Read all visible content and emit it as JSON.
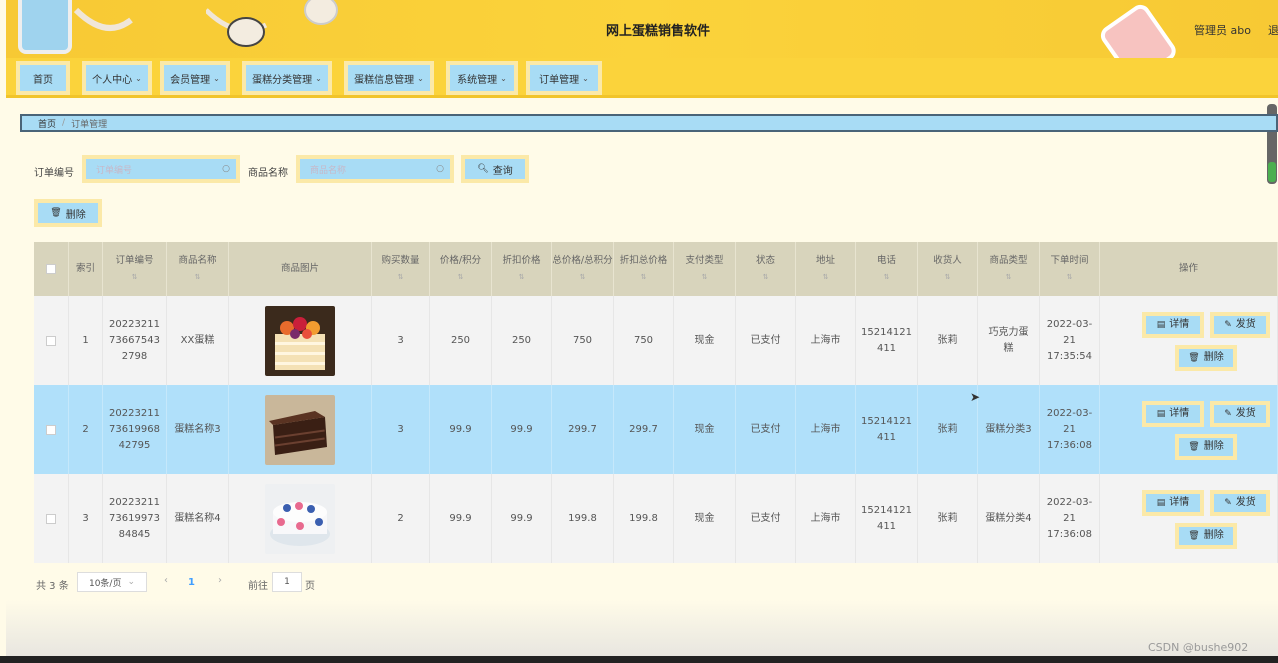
{
  "header": {
    "title": "网上蛋糕销售软件",
    "user": "管理员 abo",
    "logout": "退出"
  },
  "nav": [
    {
      "label": "首页",
      "has_menu": false
    },
    {
      "label": "个人中心",
      "has_menu": true
    },
    {
      "label": "会员管理",
      "has_menu": true
    },
    {
      "label": "蛋糕分类管理",
      "has_menu": true
    },
    {
      "label": "蛋糕信息管理",
      "has_menu": true
    },
    {
      "label": "系统管理",
      "has_menu": true
    },
    {
      "label": "订单管理",
      "has_menu": true
    }
  ],
  "breadcrumb": {
    "home": "首页",
    "separator": "/",
    "current": "订单管理"
  },
  "search": {
    "order_label": "订单编号",
    "order_placeholder": "订单编号",
    "product_label": "商品名称",
    "product_placeholder": "商品名称",
    "query_button": "查询"
  },
  "toolbar": {
    "delete_button": "删除"
  },
  "table": {
    "headers": [
      "索引",
      "订单编号",
      "商品名称",
      "商品图片",
      "购买数量",
      "价格/积分",
      "折扣价格",
      "总价格/总积分",
      "折扣总价格",
      "支付类型",
      "状态",
      "地址",
      "电话",
      "收货人",
      "商品类型",
      "下单时间",
      "操作"
    ],
    "rows": [
      {
        "index": "1",
        "order_no": "20223211 73667543 2798",
        "product": "XX蛋糕",
        "qty": "3",
        "price": "250",
        "discount": "250",
        "total": "750",
        "discount_total": "750",
        "pay": "现金",
        "status": "已支付",
        "address": "上海市",
        "phone": "15214121 411",
        "receiver": "张莉",
        "type": "巧克力蛋糕",
        "time": "2022-03-21 17:35:54",
        "image": "fruit-layer-cake"
      },
      {
        "index": "2",
        "order_no": "20223211 73619968 42795",
        "product": "蛋糕名称3",
        "qty": "3",
        "price": "99.9",
        "discount": "99.9",
        "total": "299.7",
        "discount_total": "299.7",
        "pay": "现金",
        "status": "已支付",
        "address": "上海市",
        "phone": "15214121 411",
        "receiver": "张莉",
        "type": "蛋糕分类3",
        "time": "2022-03-21 17:36:08",
        "image": "chocolate-cake-slice"
      },
      {
        "index": "3",
        "order_no": "20223211 73619973 84845",
        "product": "蛋糕名称4",
        "qty": "2",
        "price": "99.9",
        "discount": "99.9",
        "total": "199.8",
        "discount_total": "199.8",
        "pay": "现金",
        "status": "已支付",
        "address": "上海市",
        "phone": "15214121 411",
        "receiver": "张莉",
        "type": "蛋糕分类4",
        "time": "2022-03-21 17:36:08",
        "image": "floral-cake"
      }
    ],
    "selected_row": 1,
    "actions": {
      "detail": "详情",
      "ship": "发货",
      "delete": "删除"
    }
  },
  "pagination": {
    "total": "共 3 条",
    "page_size": "10条/页",
    "current_page": "1",
    "goto_label": "前往",
    "goto_value": "1",
    "page_suffix": "页"
  },
  "watermark": "CSDN @bushe902",
  "colors": {
    "header": "#fbd33b",
    "button": "#a8dcf5",
    "button_border": "#fbe9a8",
    "selected_row": "#b0e0fa"
  }
}
